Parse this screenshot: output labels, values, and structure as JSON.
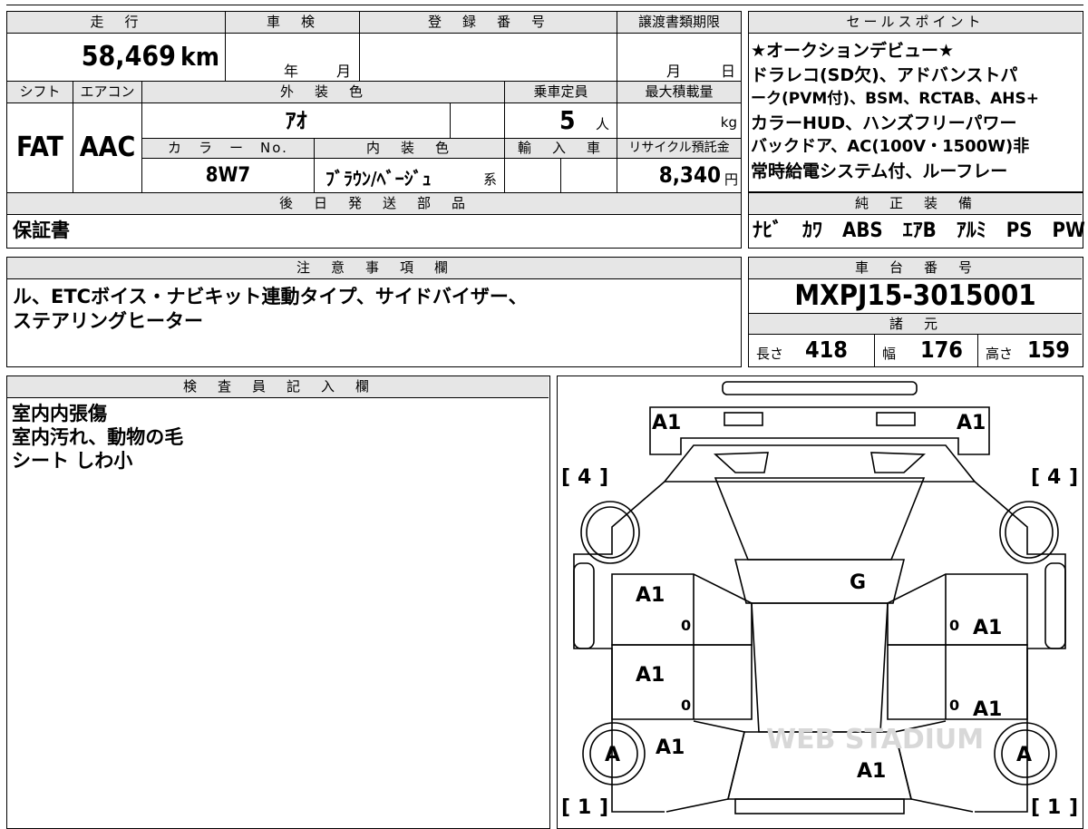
{
  "top_table": {
    "mileage_label": "走　行",
    "mileage": "58,469",
    "mileage_unit": "km",
    "shaken_label": "車　検",
    "shaken_year": "年",
    "shaken_month": "月",
    "reg_label": "登　録　番　号",
    "transfer_label": "譲渡書類期限",
    "transfer_month": "月",
    "transfer_day": "日",
    "shift_label": "シフト",
    "ac_label": "エアコン",
    "ext_color_label": "外　装　色",
    "capacity_label": "乗車定員",
    "max_load_label": "最大積載量",
    "shift": "FAT",
    "ac": "AAC",
    "ext_color": "ｱｵ",
    "capacity": "5",
    "capacity_unit": "人",
    "load_unit": "kg",
    "color_no_label": "カ　ラ　ー　No.",
    "int_color_label": "内　装　色",
    "import_label": "輸　入　車",
    "recycle_label": "リサイクル預託金",
    "color_no": "8W7",
    "int_color": "ﾌﾞﾗｳﾝ/ﾍﾞｰｼﾞｭ",
    "int_color_suffix": "系",
    "recycle": "8,340",
    "recycle_unit": "円",
    "later_parts_label": "後　日　発　送　部　品",
    "later_parts": "保証書"
  },
  "sales_points": {
    "label": "セールスポイント",
    "lines": [
      "★オークションデビュー★",
      "ドラレコ(SD欠)、アドバンストパ",
      "ーク(PVM付)、BSM、RCTAB、AHS+",
      "カラーHUD、ハンズフリーパワー",
      "バックドア、AC(100V・1500W)非",
      "常時給電システム付、ルーフレー"
    ]
  },
  "equipment": {
    "label": "純　正　装　備",
    "value": "ﾅﾋﾞ　ｶﾜ　ABS　ｴｱB　ｱﾙﾐ　PS　PW"
  },
  "notes": {
    "label": "注　意　事　項　欄",
    "lines": [
      "ル、ETCボイス・ナビキット連動タイプ、サイドバイザー、",
      "ステアリングヒーター"
    ]
  },
  "chassis": {
    "label": "車　台　番　号",
    "value": "MXPJ15-3015001",
    "spec_label": "諸　元",
    "length_label": "長さ",
    "length": "418",
    "width_label": "幅",
    "width": "176",
    "height_label": "高さ",
    "height": "159"
  },
  "inspector": {
    "label": "検　査　員　記　入　欄",
    "lines": [
      "室内内張傷",
      "室内汚れ、動物の毛",
      "シート しわ小"
    ]
  },
  "diagram": {
    "tire_fl": "4",
    "tire_fr": "4",
    "tire_rl": "1",
    "tire_rr": "1",
    "marks": {
      "front_left": "A1",
      "front_right": "A1",
      "hood": "G",
      "front_door_left": "A1",
      "rear_door_left": "A1",
      "front_door_right": "A1",
      "rear_door_right": "A1",
      "rear_fender_left": "A1",
      "roof_rear": "A1",
      "wheel_rl": "A",
      "wheel_rr": "A",
      "small_0a": "0",
      "small_0b": "0",
      "small_0c": "0",
      "small_0d": "0"
    },
    "watermark": "WEB STADIUM"
  }
}
